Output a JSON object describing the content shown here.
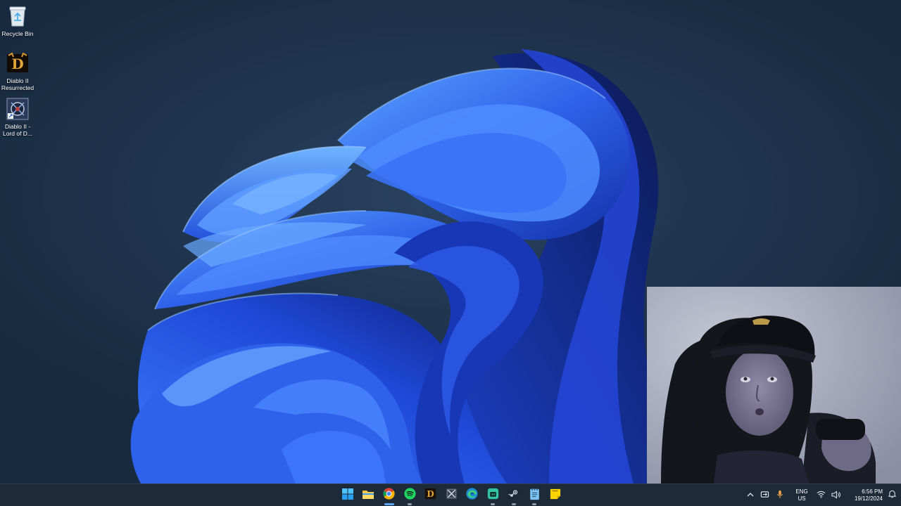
{
  "desktop": {
    "icons": [
      {
        "label": "Recycle Bin",
        "icon": "recycle-bin-icon"
      },
      {
        "label": "Diablo II Resurrected",
        "icon": "diablo-ii-resurrected-icon"
      },
      {
        "label": "Diablo II - Lord of D...",
        "icon": "diablo-ii-lod-icon"
      }
    ]
  },
  "taskbar": {
    "apps": [
      {
        "name": "Start",
        "icon": "windows-start-icon",
        "running": false
      },
      {
        "name": "File Explorer",
        "icon": "file-explorer-icon",
        "running": false
      },
      {
        "name": "Google Chrome",
        "icon": "chrome-icon",
        "running": true
      },
      {
        "name": "Spotify",
        "icon": "spotify-icon",
        "running": true
      },
      {
        "name": "Diablo II Resurrected",
        "icon": "diablo-taskbar-icon",
        "running": false
      },
      {
        "name": "Snipping Tool",
        "icon": "snipping-tool-icon",
        "running": false
      },
      {
        "name": "Microsoft Edge",
        "icon": "edge-icon",
        "running": false
      },
      {
        "name": "Streamlabs",
        "icon": "streamlabs-icon",
        "running": true
      },
      {
        "name": "Steam",
        "icon": "steam-icon",
        "running": true
      },
      {
        "name": "Notepad",
        "icon": "notepad-icon",
        "running": true
      },
      {
        "name": "Sticky Notes",
        "icon": "sticky-notes-icon",
        "running": false
      }
    ],
    "tray": {
      "language_top": "ENG",
      "language_bottom": "US",
      "time": "6:56 PM",
      "date": "19/12/2024"
    }
  },
  "colors": {
    "accent": "#5aa7f2",
    "taskbar_bg": "#1d2a38",
    "wallpaper_bloom": "#2f66e8"
  }
}
